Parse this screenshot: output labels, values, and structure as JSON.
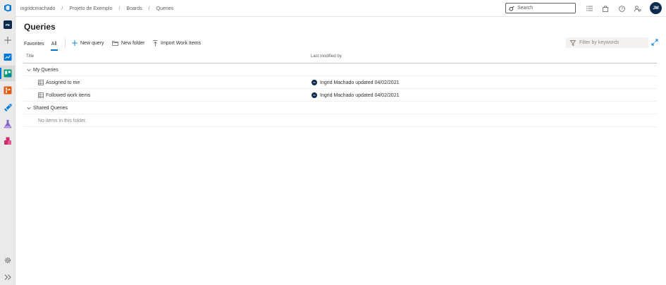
{
  "breadcrumb": {
    "org": "ingridcmachado",
    "project": "Projeto de Exemplo",
    "section": "Boards",
    "page": "Queries"
  },
  "search": {
    "placeholder": "Search"
  },
  "user": {
    "initials": "JM"
  },
  "rail": {
    "project_initials": "PE"
  },
  "page": {
    "title": "Queries"
  },
  "tabs": [
    {
      "label": "Favorites"
    },
    {
      "label": "All"
    }
  ],
  "commands": {
    "new_query": "New query",
    "new_folder": "New folder",
    "import": "Import Work Items"
  },
  "filter": {
    "placeholder": "Filter by keywords"
  },
  "table": {
    "columns": {
      "title": "Title",
      "last_modified": "Last modified by"
    },
    "folders": [
      {
        "name": "My Queries",
        "items": [
          {
            "name": "Assigned to me",
            "avatar": "IM",
            "modified": "Ingrid Machado updated 04/02/2021"
          },
          {
            "name": "Followed work items",
            "avatar": "IM",
            "modified": "Ingrid Machado updated 04/02/2021"
          }
        ]
      },
      {
        "name": "Shared Queries",
        "empty_text": "No items in this folder."
      }
    ]
  },
  "colors": {
    "accent": "#0078d4",
    "avatar": "#0c2a4d"
  }
}
